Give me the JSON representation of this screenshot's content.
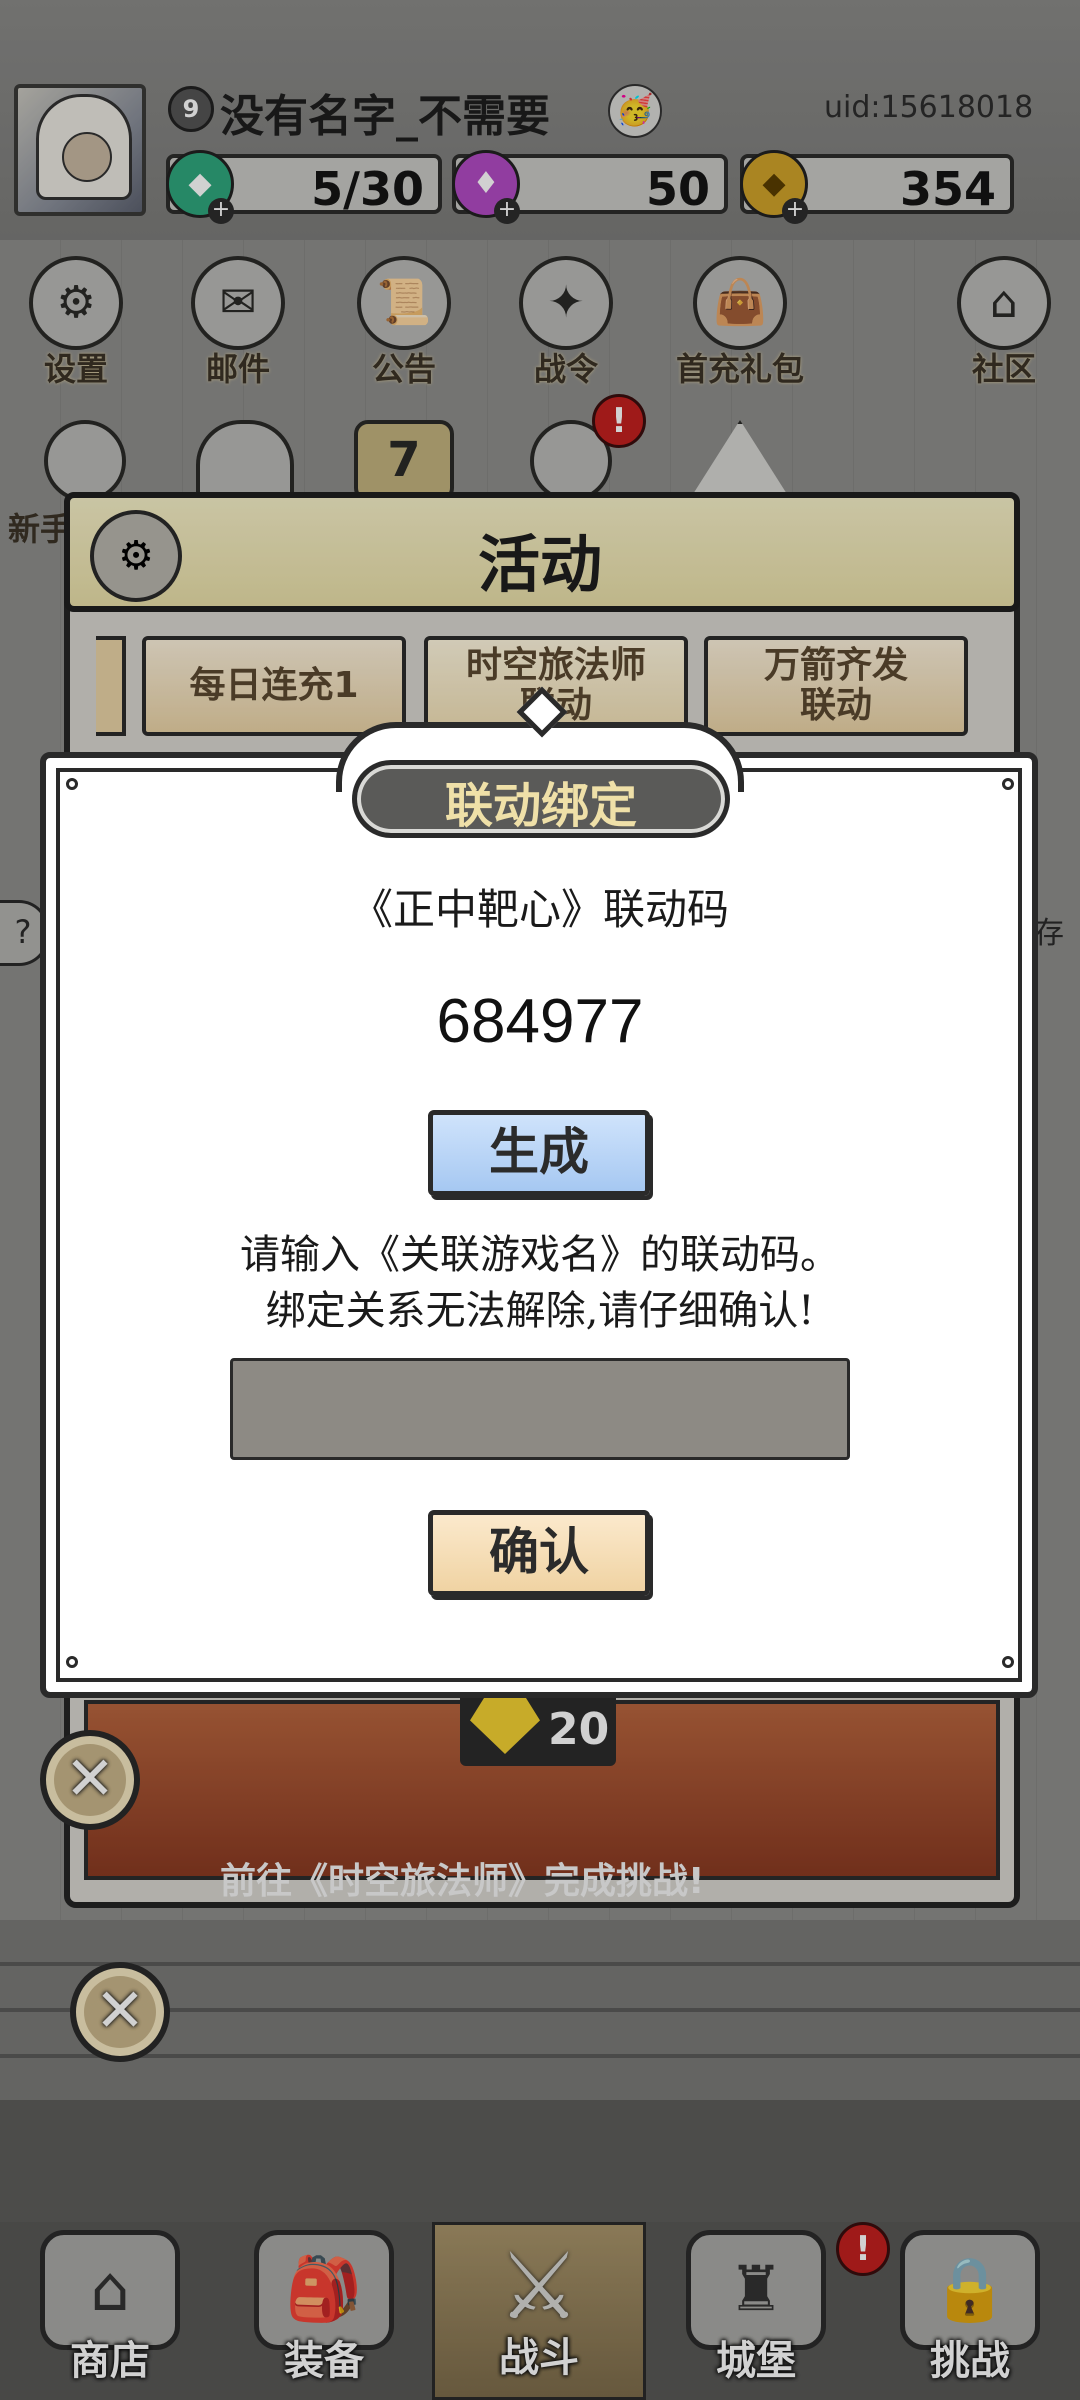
{
  "hud": {
    "level": "9",
    "player_name": "没有名字_不需要",
    "emoji": "🥳",
    "uid": "uid:15618018",
    "resources": [
      {
        "name": "energy",
        "value": "5/30",
        "icon": "green-crystal-icon",
        "color": "#2fa77d"
      },
      {
        "name": "gems",
        "value": "50",
        "icon": "purple-gem-icon",
        "color": "#b14bc4"
      },
      {
        "name": "coins",
        "value": "354",
        "icon": "gold-coin-icon",
        "color": "#d0a32a"
      }
    ]
  },
  "menu_top": [
    {
      "label": "设置",
      "icon": "gear-icon"
    },
    {
      "label": "邮件",
      "icon": "mail-icon"
    },
    {
      "label": "公告",
      "icon": "scroll-icon"
    },
    {
      "label": "战令",
      "icon": "crystal-ball-icon"
    },
    {
      "label": "首充礼包",
      "icon": "gift-bag-icon"
    },
    {
      "label": "社区",
      "icon": "home-chat-icon"
    }
  ],
  "menu_second": {
    "partial_label": "新手",
    "badge": "!",
    "medal_number": "7"
  },
  "activity": {
    "title": "活动",
    "tabs": [
      {
        "label": "每日连充1"
      },
      {
        "label": "时空旅法师联动"
      },
      {
        "label": "万箭齐发联动"
      }
    ],
    "reward_count": "20",
    "banner_text": "前往《时空旅法师》完成挑战!"
  },
  "side_fragment": "存",
  "modal": {
    "title": "联动绑定",
    "code_label": "《正中靶心》联动码",
    "code_value": "684977",
    "generate_label": "生成",
    "instruction_line1": "请输入《关联游戏名》的联动码。",
    "instruction_line2": "绑定关系无法解除,请仔细确认!",
    "input_value": "",
    "confirm_label": "确认"
  },
  "close_glyph": "✕",
  "bottom_nav": [
    {
      "label": "商店",
      "icon": "shop-hut-icon"
    },
    {
      "label": "装备",
      "icon": "backpack-icon"
    },
    {
      "label": "战斗",
      "icon": "crossed-swords-icon",
      "active": true
    },
    {
      "label": "城堡",
      "icon": "castle-hat-icon",
      "badge": "!"
    },
    {
      "label": "挑战",
      "icon": "locked-armor-icon"
    }
  ]
}
